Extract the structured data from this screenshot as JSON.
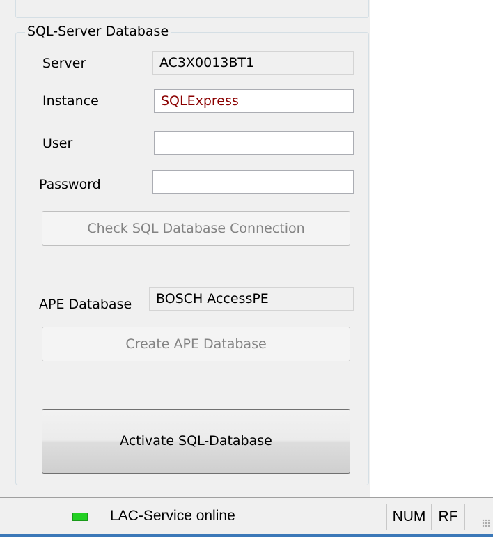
{
  "group": {
    "title": "SQL-Server Database",
    "server_label": "Server",
    "server_value": "AC3X0013BT1",
    "instance_label": "Instance",
    "instance_value": "SQLExpress",
    "user_label": "User",
    "user_value": "",
    "password_label": "Password",
    "password_value": "",
    "check_button": "Check SQL Database Connection",
    "ape_label": "APE Database",
    "ape_value": "BOSCH AccessPE",
    "create_button": "Create APE Database",
    "activate_button": "Activate SQL-Database"
  },
  "statusbar": {
    "service_text": "LAC-Service online",
    "service_status": "online",
    "num": "NUM",
    "rf": "RF"
  },
  "colors": {
    "instance_text": "#8b0000",
    "status_led": "#22d022"
  }
}
